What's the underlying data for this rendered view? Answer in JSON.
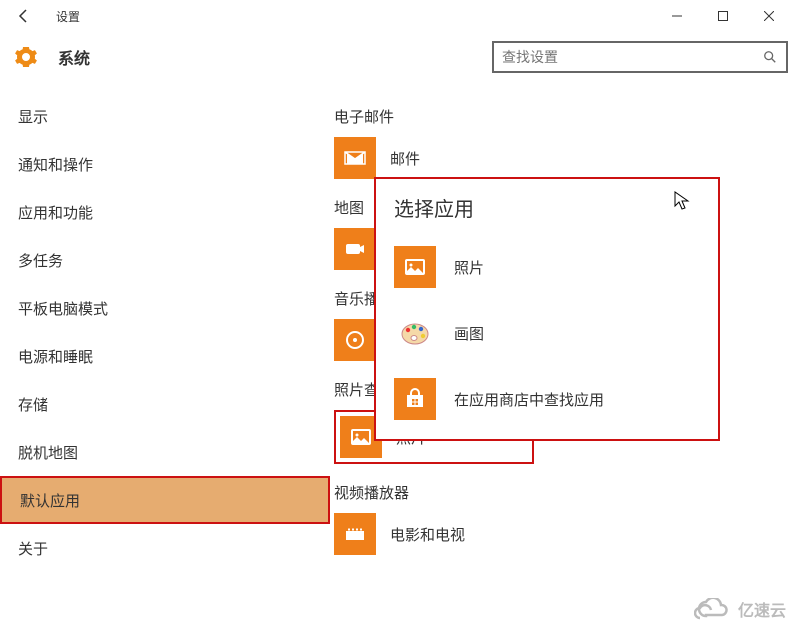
{
  "window": {
    "title": "设置"
  },
  "header": {
    "title": "系统"
  },
  "search": {
    "placeholder": "查找设置"
  },
  "sidebar": {
    "items": [
      {
        "label": "显示"
      },
      {
        "label": "通知和操作"
      },
      {
        "label": "应用和功能"
      },
      {
        "label": "多任务"
      },
      {
        "label": "平板电脑模式"
      },
      {
        "label": "电源和睡眠"
      },
      {
        "label": "存储"
      },
      {
        "label": "脱机地图"
      },
      {
        "label": "默认应用"
      },
      {
        "label": "关于"
      }
    ]
  },
  "content": {
    "sections": {
      "email": {
        "label": "电子邮件",
        "app": "邮件"
      },
      "map": {
        "label": "地图"
      },
      "music": {
        "label": "音乐播"
      },
      "photo_viewer": {
        "label": "照片查",
        "app": "照片"
      },
      "video": {
        "label": "视频播放器",
        "app": "电影和电视"
      }
    }
  },
  "popup": {
    "title": "选择应用",
    "items": [
      {
        "label": "照片"
      },
      {
        "label": "画图"
      },
      {
        "label": "在应用商店中查找应用"
      }
    ]
  },
  "colors": {
    "accent": "#ef7f1a",
    "highlight_border": "#c11"
  },
  "watermark": "亿速云"
}
